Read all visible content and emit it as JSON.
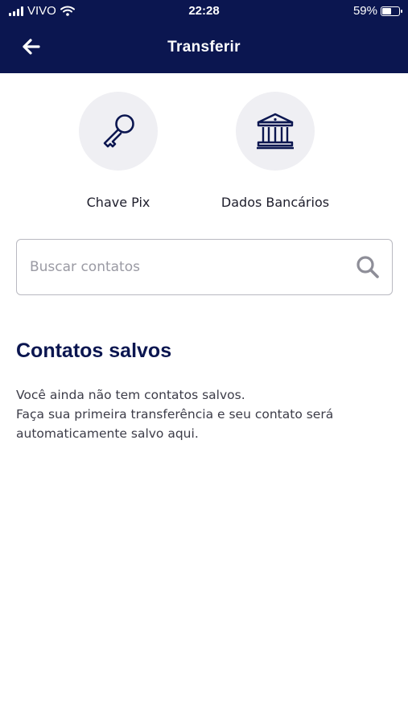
{
  "status_bar": {
    "carrier": "VIVO",
    "time": "22:28",
    "battery": "59%",
    "battery_level": 0.59
  },
  "header": {
    "title": "Transferir",
    "back_icon": "arrow-left-icon"
  },
  "options": [
    {
      "label": "Chave Pix",
      "icon": "key-icon"
    },
    {
      "label": "Dados Bancários",
      "icon": "bank-icon"
    }
  ],
  "search": {
    "placeholder": "Buscar contatos",
    "value": "",
    "icon": "search-icon"
  },
  "saved_contacts": {
    "title": "Contatos salvos",
    "empty_line1": "Você ainda não tem contatos salvos.",
    "empty_line2": "Faça sua primeira transferência e seu contato será automaticamente salvo aqui."
  },
  "colors": {
    "header_bg": "#0b1650",
    "accent": "#0b1650",
    "icon_circle": "#efeff3"
  }
}
